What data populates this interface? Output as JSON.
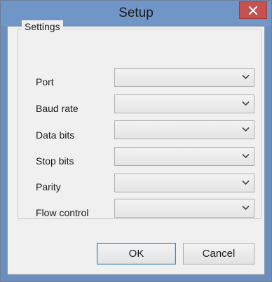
{
  "window": {
    "title": "Setup",
    "close_icon": "close-icon"
  },
  "settings": {
    "group_label": "Settings",
    "fields": [
      {
        "label": "Port",
        "value": ""
      },
      {
        "label": "Baud rate",
        "value": ""
      },
      {
        "label": "Data bits",
        "value": ""
      },
      {
        "label": "Stop bits",
        "value": ""
      },
      {
        "label": "Parity",
        "value": ""
      },
      {
        "label": "Flow control",
        "value": ""
      }
    ]
  },
  "buttons": {
    "ok": "OK",
    "cancel": "Cancel"
  },
  "colors": {
    "titlebar": "#7096c8",
    "close_button": "#c75050",
    "client_background": "#f0f0f0"
  }
}
